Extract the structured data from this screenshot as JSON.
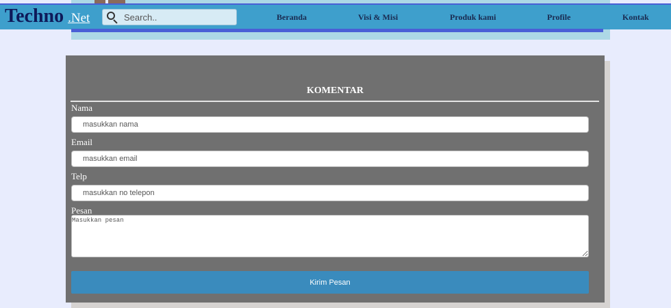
{
  "header": {
    "brand": "Techno",
    "brand_suffix": ".Net",
    "search_placeholder": "Search..",
    "nav": [
      "Beranda",
      "Visi & Misi",
      "Produk kami",
      "Profile",
      "Kontak"
    ]
  },
  "form": {
    "title": "KOMENTAR",
    "fields": [
      {
        "label": "Nama",
        "placeholder": "masukkan nama"
      },
      {
        "label": "Email",
        "placeholder": "masukkan email"
      },
      {
        "label": "Telp",
        "placeholder": "masukkan no telepon"
      }
    ],
    "message": {
      "label": "Pesan",
      "placeholder": "Masukkan pesan"
    },
    "submit_label": "Kirim Pesan"
  },
  "colors": {
    "page_bg": "#e8ecfd",
    "header_bg": "#3e9fcc",
    "panel_bg": "#707070",
    "button_bg": "#3a8bbd"
  }
}
